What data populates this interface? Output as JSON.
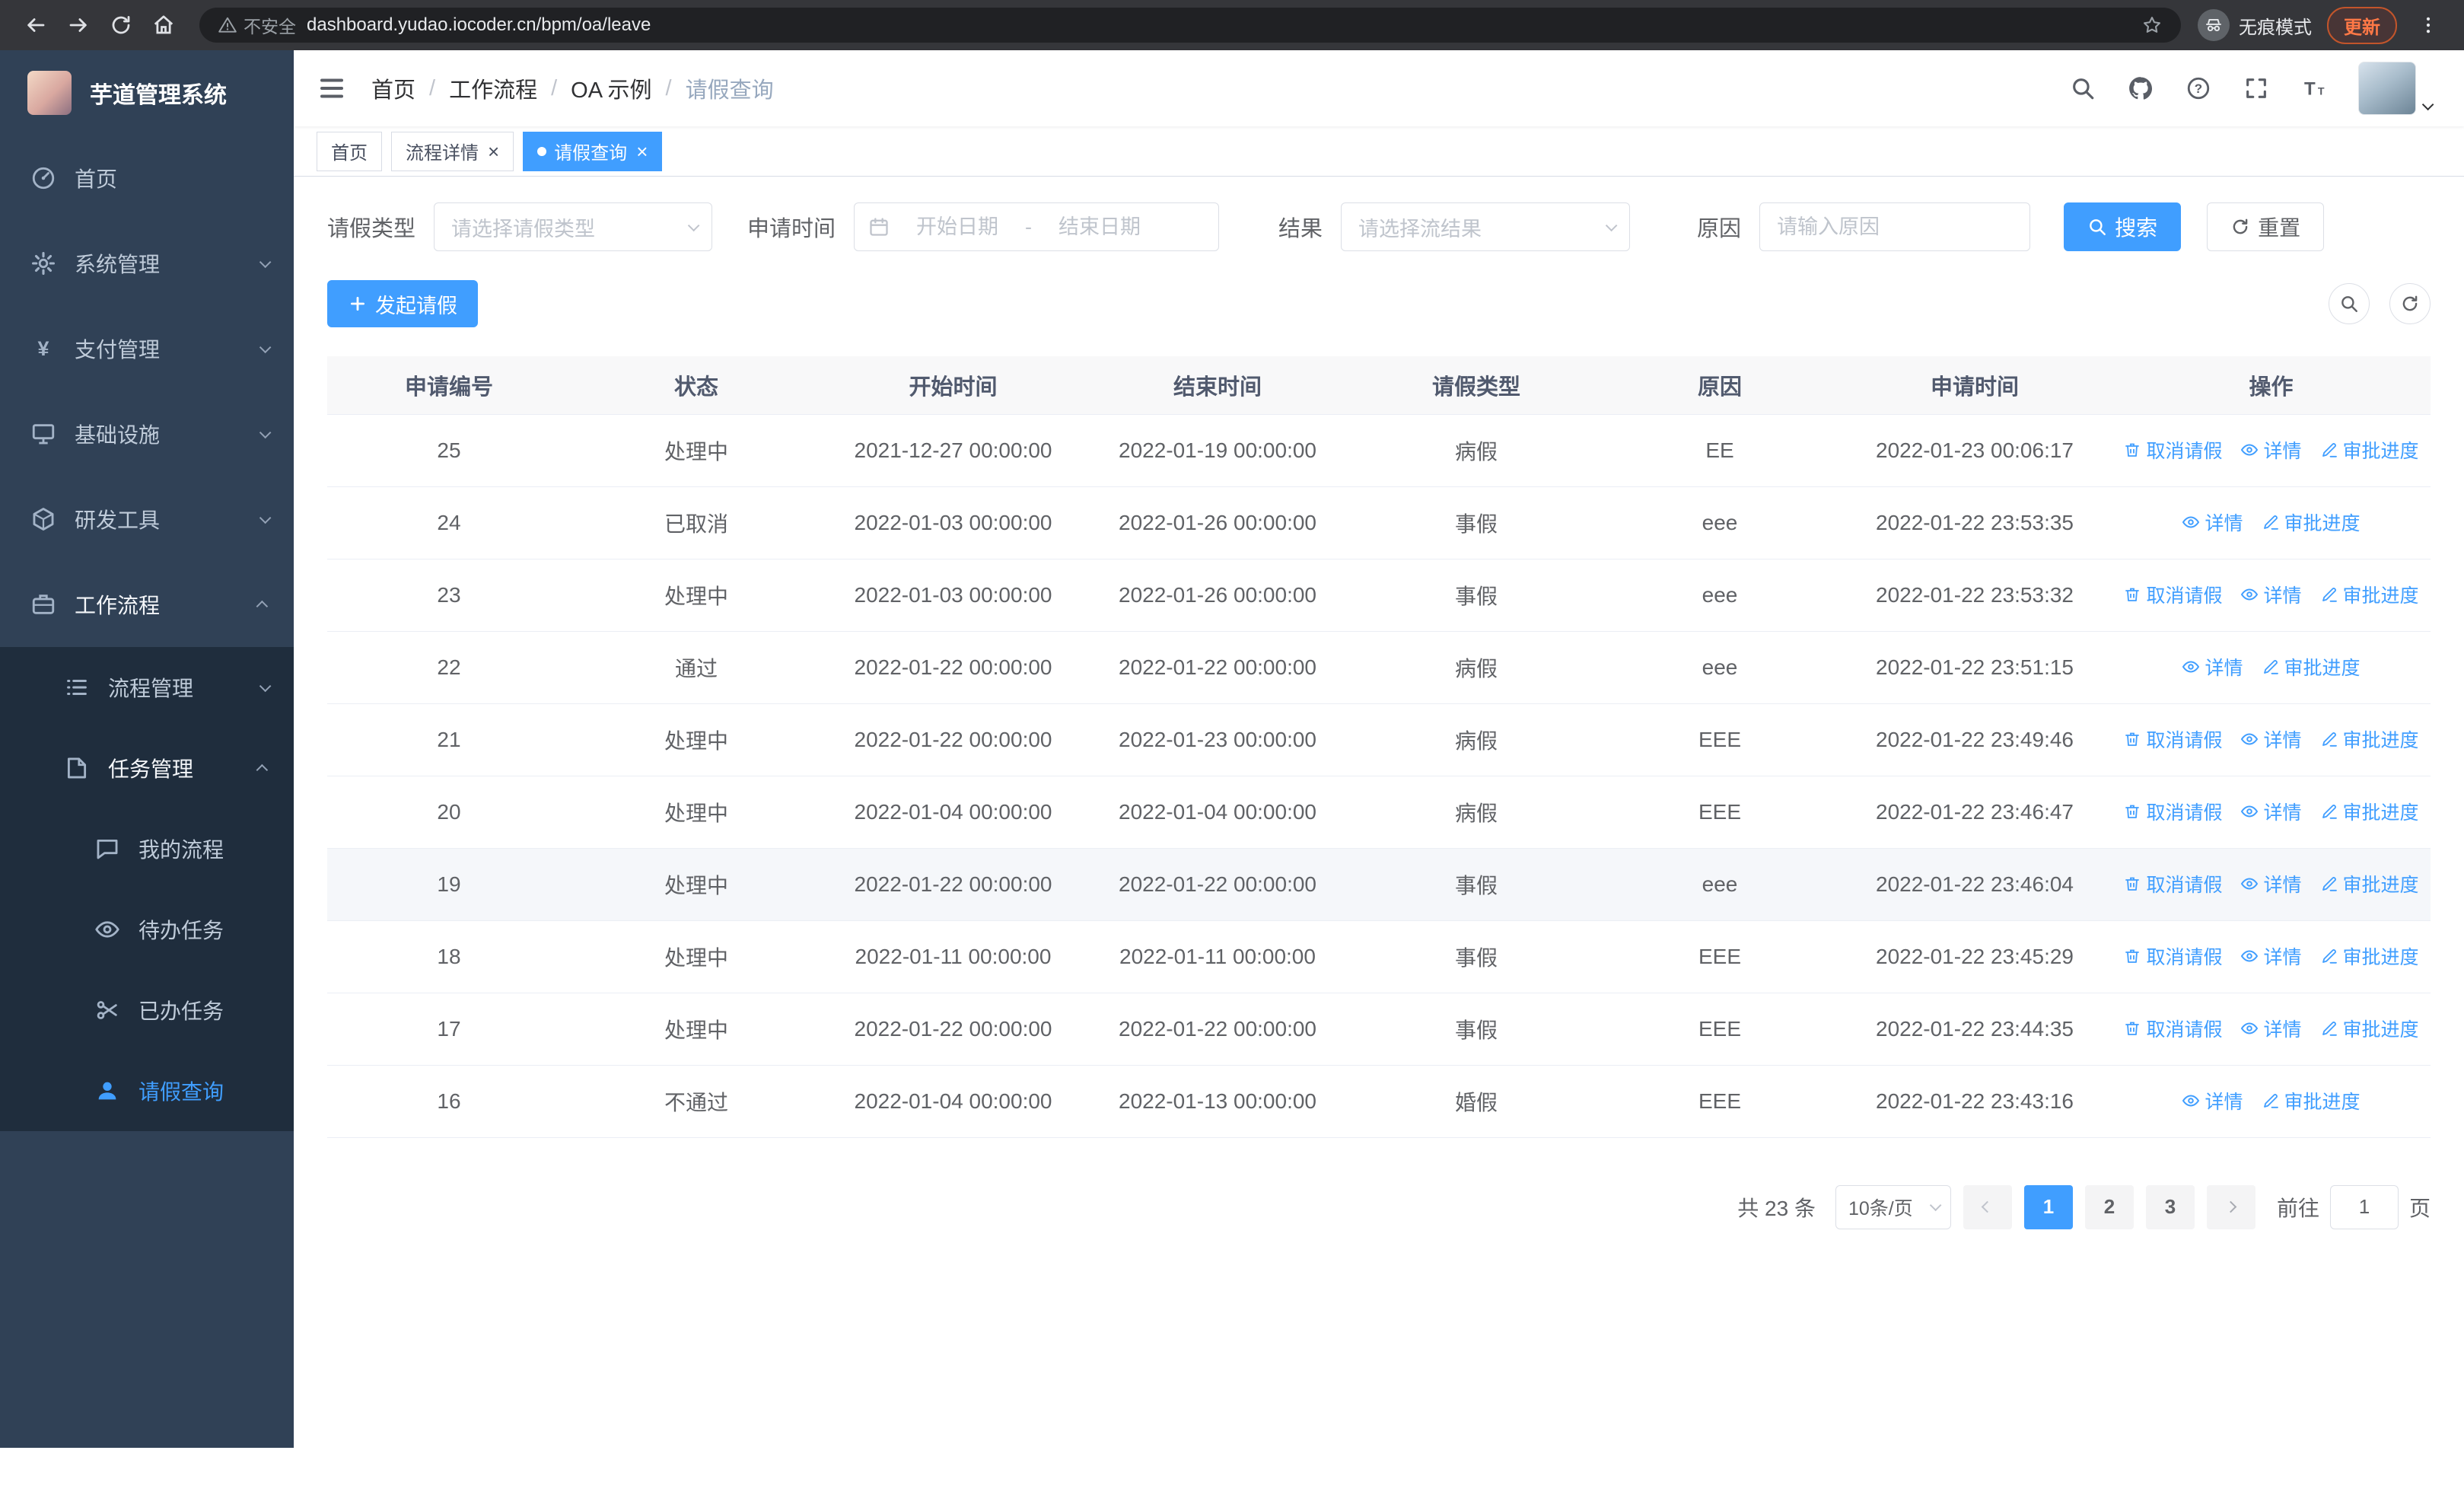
{
  "browser": {
    "security_label": "不安全",
    "url": "dashboard.yudao.iocoder.cn/bpm/oa/leave",
    "incognito_label": "无痕模式",
    "update_label": "更新"
  },
  "sidebar": {
    "logo_title": "芋道管理系统",
    "items": [
      {
        "key": "home",
        "label": "首页",
        "level": 1,
        "icon": "dashboard"
      },
      {
        "key": "system-management",
        "label": "系统管理",
        "level": 1,
        "icon": "gear",
        "chevron": "down"
      },
      {
        "key": "payment-management",
        "label": "支付管理",
        "level": 1,
        "icon": "yen",
        "chevron": "down"
      },
      {
        "key": "infrastructure",
        "label": "基础设施",
        "level": 1,
        "icon": "infra",
        "chevron": "down"
      },
      {
        "key": "dev-tools",
        "label": "研发工具",
        "level": 1,
        "icon": "tools",
        "chevron": "down"
      },
      {
        "key": "workflow",
        "label": "工作流程",
        "level": 1,
        "icon": "workflow",
        "chevron": "up",
        "expanded": true
      },
      {
        "key": "process-management",
        "label": "流程管理",
        "level": 2,
        "icon": "list",
        "chevron": "down"
      },
      {
        "key": "task-management",
        "label": "任务管理",
        "level": 2,
        "icon": "task",
        "chevron": "up",
        "expanded": true
      },
      {
        "key": "my-process",
        "label": "我的流程",
        "level": 3,
        "icon": "chat"
      },
      {
        "key": "todo-tasks",
        "label": "待办任务",
        "level": 3,
        "icon": "eye"
      },
      {
        "key": "done-tasks",
        "label": "已办任务",
        "level": 3,
        "icon": "done"
      },
      {
        "key": "leave-query",
        "label": "请假查询",
        "level": 3,
        "icon": "user",
        "active": true
      }
    ]
  },
  "header": {
    "breadcrumb": [
      "首页",
      "工作流程",
      "OA 示例",
      "请假查询"
    ]
  },
  "tabs": [
    {
      "key": "home",
      "label": "首页",
      "active": false,
      "closable": false
    },
    {
      "key": "process-detail",
      "label": "流程详情",
      "active": false,
      "closable": true
    },
    {
      "key": "leave-query",
      "label": "请假查询",
      "active": true,
      "closable": true
    }
  ],
  "filters": {
    "leave_type_label": "请假类型",
    "leave_type_placeholder": "请选择请假类型",
    "apply_time_label": "申请时间",
    "start_date_placeholder": "开始日期",
    "range_separator": "-",
    "end_date_placeholder": "结束日期",
    "result_label": "结果",
    "result_placeholder": "请选择流结果",
    "reason_label": "原因",
    "reason_placeholder": "请输入原因",
    "search_label": "搜索",
    "reset_label": "重置"
  },
  "toolbar": {
    "create_label": "发起请假"
  },
  "table": {
    "columns": [
      "申请编号",
      "状态",
      "开始时间",
      "结束时间",
      "请假类型",
      "原因",
      "申请时间",
      "操作"
    ],
    "action_labels": {
      "cancel": "取消请假",
      "detail": "详情",
      "progress": "审批进度"
    },
    "rows": [
      {
        "id": "25",
        "status": "处理中",
        "start": "2021-12-27 00:00:00",
        "end": "2022-01-19 00:00:00",
        "type": "病假",
        "reason": "EE",
        "applied": "2022-01-23 00:06:17",
        "actions": [
          "cancel",
          "detail",
          "progress"
        ]
      },
      {
        "id": "24",
        "status": "已取消",
        "start": "2022-01-03 00:00:00",
        "end": "2022-01-26 00:00:00",
        "type": "事假",
        "reason": "eee",
        "applied": "2022-01-22 23:53:35",
        "actions": [
          "detail",
          "progress"
        ]
      },
      {
        "id": "23",
        "status": "处理中",
        "start": "2022-01-03 00:00:00",
        "end": "2022-01-26 00:00:00",
        "type": "事假",
        "reason": "eee",
        "applied": "2022-01-22 23:53:32",
        "actions": [
          "cancel",
          "detail",
          "progress"
        ]
      },
      {
        "id": "22",
        "status": "通过",
        "start": "2022-01-22 00:00:00",
        "end": "2022-01-22 00:00:00",
        "type": "病假",
        "reason": "eee",
        "applied": "2022-01-22 23:51:15",
        "actions": [
          "detail",
          "progress"
        ]
      },
      {
        "id": "21",
        "status": "处理中",
        "start": "2022-01-22 00:00:00",
        "end": "2022-01-23 00:00:00",
        "type": "病假",
        "reason": "EEE",
        "applied": "2022-01-22 23:49:46",
        "actions": [
          "cancel",
          "detail",
          "progress"
        ]
      },
      {
        "id": "20",
        "status": "处理中",
        "start": "2022-01-04 00:00:00",
        "end": "2022-01-04 00:00:00",
        "type": "病假",
        "reason": "EEE",
        "applied": "2022-01-22 23:46:47",
        "actions": [
          "cancel",
          "detail",
          "progress"
        ]
      },
      {
        "id": "19",
        "status": "处理中",
        "start": "2022-01-22 00:00:00",
        "end": "2022-01-22 00:00:00",
        "type": "事假",
        "reason": "eee",
        "applied": "2022-01-22 23:46:04",
        "actions": [
          "cancel",
          "detail",
          "progress"
        ],
        "hover": true
      },
      {
        "id": "18",
        "status": "处理中",
        "start": "2022-01-11 00:00:00",
        "end": "2022-01-11 00:00:00",
        "type": "事假",
        "reason": "EEE",
        "applied": "2022-01-22 23:45:29",
        "actions": [
          "cancel",
          "detail",
          "progress"
        ]
      },
      {
        "id": "17",
        "status": "处理中",
        "start": "2022-01-22 00:00:00",
        "end": "2022-01-22 00:00:00",
        "type": "事假",
        "reason": "EEE",
        "applied": "2022-01-22 23:44:35",
        "actions": [
          "cancel",
          "detail",
          "progress"
        ]
      },
      {
        "id": "16",
        "status": "不通过",
        "start": "2022-01-04 00:00:00",
        "end": "2022-01-13 00:00:00",
        "type": "婚假",
        "reason": "EEE",
        "applied": "2022-01-22 23:43:16",
        "actions": [
          "detail",
          "progress"
        ]
      }
    ]
  },
  "pagination": {
    "total_label": "共 23 条",
    "page_size_label": "10条/页",
    "pages": [
      "1",
      "2",
      "3"
    ],
    "active_page": "1",
    "goto_label": "前往",
    "goto_value": "1",
    "page_unit_label": "页"
  },
  "colors": {
    "accent": "#409eff",
    "sidebar_bg": "#304156",
    "submenu_bg": "#1f2d3d"
  }
}
